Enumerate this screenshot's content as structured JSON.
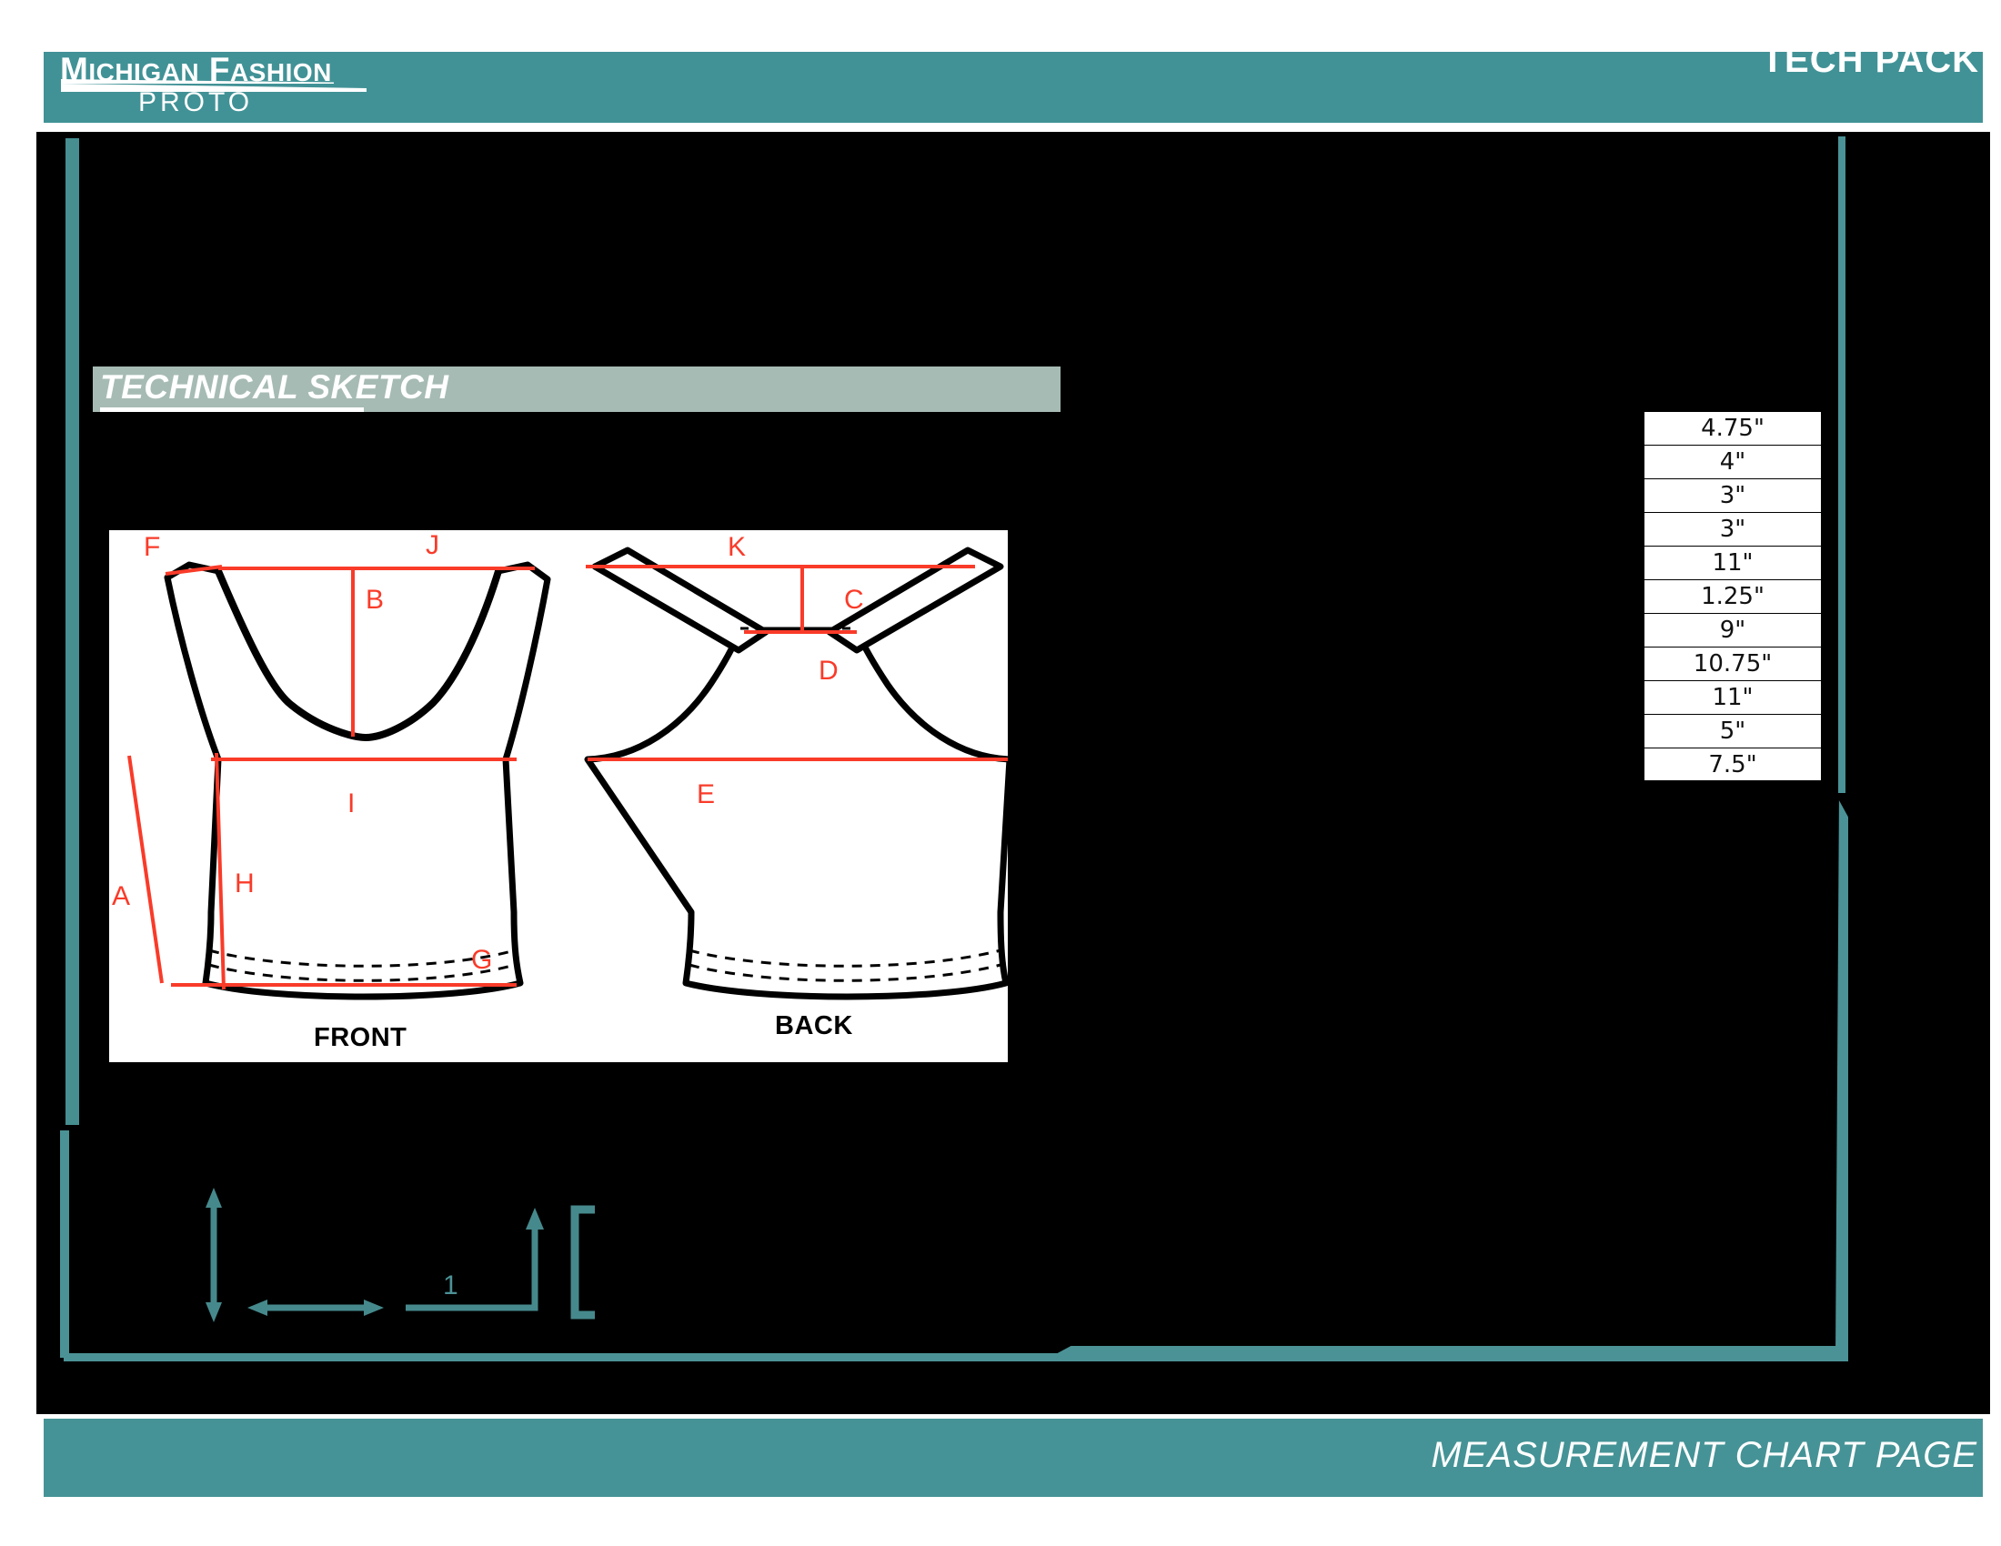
{
  "header": {
    "logo_line1_big": "M",
    "logo_line1_rest": "ICHIGAN ",
    "logo_line1_big2": "F",
    "logo_line1_rest2": "ASHION",
    "logo_line1_full": "MICHIGAN FASHION",
    "logo_line2": "PROTO",
    "title": "TECH PACK"
  },
  "section": {
    "title": "TECHNICAL SKETCH"
  },
  "sketch": {
    "front_caption": "FRONT",
    "back_caption": "BACK",
    "front_labels": [
      "F",
      "J",
      "B",
      "I",
      "A",
      "H",
      "G"
    ],
    "back_labels": [
      "K",
      "C",
      "D",
      "E"
    ],
    "label_F": "F",
    "label_J": "J",
    "label_B": "B",
    "label_I": "I",
    "label_A": "A",
    "label_H": "H",
    "label_G": "G",
    "label_K": "K",
    "label_C": "C",
    "label_D": "D",
    "label_E": "E"
  },
  "measurement_table": {
    "rows": [
      {
        "value": "4.75\""
      },
      {
        "value": "4\""
      },
      {
        "value": "3\""
      },
      {
        "value": "3\""
      },
      {
        "value": "11\""
      },
      {
        "value": "1.25\""
      },
      {
        "value": "9\""
      },
      {
        "value": "10.75\""
      },
      {
        "value": "11\""
      },
      {
        "value": "5\""
      },
      {
        "value": "7.5\""
      }
    ]
  },
  "decoration": {
    "callout_number": "1"
  },
  "footer": {
    "text": "MEASUREMENT CHART PAGE"
  },
  "colors": {
    "teal": "#419296",
    "teal_frame": "#4b9296",
    "sage": "#a6bbb4",
    "red": "#f93b29",
    "black": "#000000",
    "white": "#ffffff"
  }
}
